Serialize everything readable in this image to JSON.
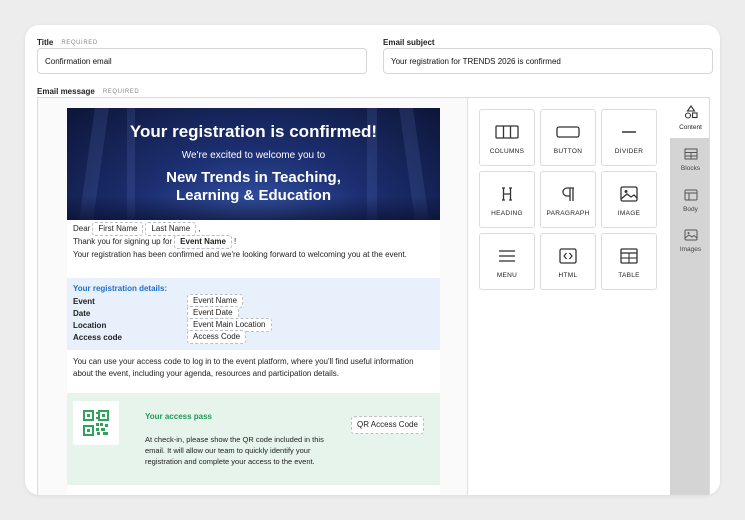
{
  "form": {
    "title_label": "Title",
    "title_required": "REQUIRED",
    "title_value": "Confirmation email",
    "subject_label": "Email subject",
    "subject_value": "Your registration for TRENDS 2026 is confirmed",
    "message_label": "Email message",
    "message_required": "REQUIRED"
  },
  "email": {
    "banner_title": "Your registration is confirmed!",
    "banner_subtitle": "We're excited to welcome you to",
    "banner_heading_line1": "New Trends in Teaching,",
    "banner_heading_line2": "Learning & Education",
    "dear": "Dear",
    "first_name_tag": "First Name",
    "last_name_tag": "Last Name",
    "comma": ",",
    "thanks": "Thank you for signing up for",
    "event_name_tag": "Event Name",
    "exclaim": "!",
    "confirmed_line": "Your registration has been confirmed and we're looking forward to welcoming you at the event.",
    "details_title": "Your registration details:",
    "details": [
      {
        "label": "Event",
        "tag": "Event Name"
      },
      {
        "label": "Date",
        "tag": "Event Date"
      },
      {
        "label": "Location",
        "tag": "Event Main Location"
      },
      {
        "label": "Access code",
        "tag": "Access Code"
      }
    ],
    "access_para": "You can use your access code to log in to the event platform, where you'll find useful information about the event, including your agenda, resources and participation details.",
    "pass_title": "Your access pass",
    "pass_text": "At check-in, please show the QR code included in this email. It will allow our team to quickly identify your registration and complete your access to the event.",
    "qr_tag": "QR Access Code"
  },
  "blocks": [
    {
      "label": "COLUMNS",
      "icon": "columns-icon"
    },
    {
      "label": "BUTTON",
      "icon": "button-icon"
    },
    {
      "label": "DIVIDER",
      "icon": "divider-icon"
    },
    {
      "label": "HEADING",
      "icon": "heading-icon"
    },
    {
      "label": "PARAGRAPH",
      "icon": "paragraph-icon"
    },
    {
      "label": "IMAGE",
      "icon": "image-icon"
    },
    {
      "label": "MENU",
      "icon": "menu-icon"
    },
    {
      "label": "HTML",
      "icon": "html-icon"
    },
    {
      "label": "TABLE",
      "icon": "table-icon"
    }
  ],
  "sidebar": [
    {
      "label": "Content",
      "icon": "shapes-icon",
      "active": true
    },
    {
      "label": "Blocks",
      "icon": "blocks-icon"
    },
    {
      "label": "Body",
      "icon": "body-icon"
    },
    {
      "label": "Images",
      "icon": "images-icon"
    }
  ],
  "colors": {
    "banner_dark": "#0d1638",
    "banner_mid": "#1c2f72",
    "details_bg": "#e8f1fb",
    "details_title": "#1d6fd1",
    "pass_bg": "#e6f4ec",
    "pass_title": "#1f9b57",
    "sidebar_bg": "#d4d4d4"
  }
}
